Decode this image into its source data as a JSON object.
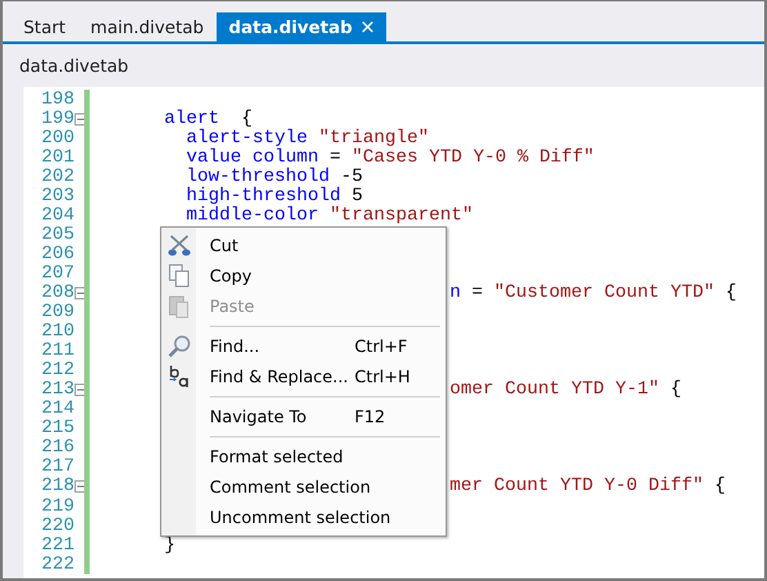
{
  "tabs": [
    {
      "label": "Start",
      "selected": false
    },
    {
      "label": "main.divetab",
      "selected": false
    },
    {
      "label": "data.divetab",
      "selected": true
    }
  ],
  "breadcrumb": "data.divetab",
  "editor": {
    "lines": [
      {
        "number": "198"
      },
      {
        "number": "199",
        "fold": true,
        "segments": [
          {
            "kind": "keyword",
            "text": "      alert"
          },
          {
            "kind": "plain",
            "text": "  {"
          }
        ]
      },
      {
        "number": "200",
        "segments": [
          {
            "kind": "keyword",
            "text": "        alert-style"
          },
          {
            "kind": "string",
            "text": " \"triangle\""
          }
        ]
      },
      {
        "number": "201",
        "segments": [
          {
            "kind": "keyword",
            "text": "        value column"
          },
          {
            "kind": "plain",
            "text": " = "
          },
          {
            "kind": "string",
            "text": "\"Cases YTD Y-0 % Diff\""
          }
        ]
      },
      {
        "number": "202",
        "segments": [
          {
            "kind": "keyword",
            "text": "        low-threshold"
          },
          {
            "kind": "plain",
            "text": " -5"
          }
        ]
      },
      {
        "number": "203",
        "segments": [
          {
            "kind": "keyword",
            "text": "        high-threshold"
          },
          {
            "kind": "plain",
            "text": " 5"
          }
        ]
      },
      {
        "number": "204",
        "segments": [
          {
            "kind": "keyword",
            "text": "        middle-color"
          },
          {
            "kind": "string",
            "text": " \"transparent\""
          }
        ]
      },
      {
        "number": "205"
      },
      {
        "number": "206"
      },
      {
        "number": "207"
      },
      {
        "number": "208",
        "fold": true,
        "covered": true,
        "segments": [
          {
            "kind": "keyword",
            "text": "n"
          },
          {
            "kind": "plain",
            "text": " = "
          },
          {
            "kind": "string",
            "text": "\"Customer Count YTD\""
          },
          {
            "kind": "plain",
            "text": " {"
          }
        ]
      },
      {
        "number": "209"
      },
      {
        "number": "210"
      },
      {
        "number": "211"
      },
      {
        "number": "212"
      },
      {
        "number": "213",
        "fold": true,
        "covered": true,
        "segments": [
          {
            "kind": "string",
            "text": "omer Count YTD Y-1\""
          },
          {
            "kind": "plain",
            "text": " {"
          }
        ]
      },
      {
        "number": "214"
      },
      {
        "number": "215"
      },
      {
        "number": "216"
      },
      {
        "number": "217"
      },
      {
        "number": "218",
        "fold": true,
        "covered": true,
        "segments": [
          {
            "kind": "string",
            "text": "mer Count YTD Y-0 Diff\""
          },
          {
            "kind": "plain",
            "text": " {"
          }
        ]
      },
      {
        "number": "219"
      },
      {
        "number": "220"
      },
      {
        "number": "221",
        "segments": [
          {
            "kind": "plain",
            "text": "      }"
          }
        ]
      },
      {
        "number": "222"
      }
    ]
  },
  "context_menu": [
    {
      "kind": "item",
      "label": "Cut",
      "disabled": false
    },
    {
      "kind": "item",
      "label": "Copy",
      "disabled": false
    },
    {
      "kind": "item",
      "label": "Paste",
      "disabled": true
    },
    {
      "kind": "separator"
    },
    {
      "kind": "item",
      "label": "Find...",
      "shortcut": "Ctrl+F",
      "disabled": false
    },
    {
      "kind": "item",
      "label": "Find & Replace...",
      "shortcut": "Ctrl+H",
      "disabled": false
    },
    {
      "kind": "separator"
    },
    {
      "kind": "item",
      "label": "Navigate To",
      "shortcut": "F12",
      "disabled": false
    },
    {
      "kind": "separator"
    },
    {
      "kind": "item",
      "label": "Format selected",
      "disabled": false
    },
    {
      "kind": "item",
      "label": "Comment selection",
      "disabled": false
    },
    {
      "kind": "item",
      "label": "Uncomment selection",
      "disabled": false
    }
  ]
}
